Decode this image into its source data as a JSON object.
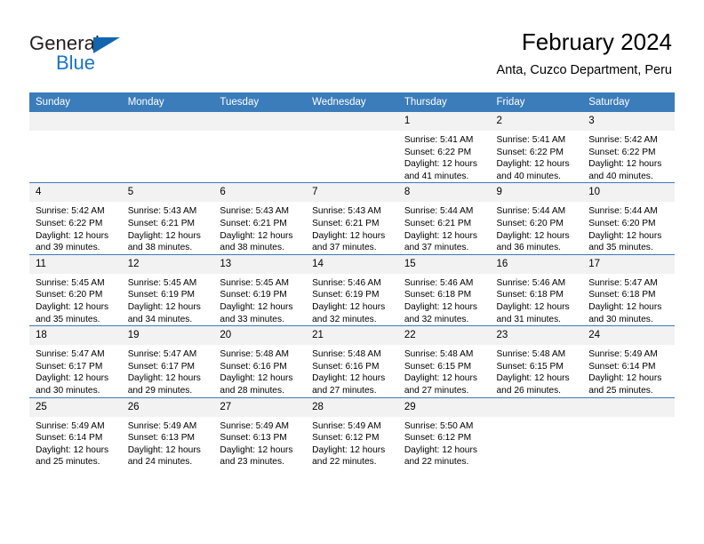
{
  "brand": {
    "name_top": "General",
    "name_bottom": "Blue",
    "triangle_icon": "blue-triangle-logo-mark",
    "color_dark": "#231f20",
    "color_blue": "#1a74c4"
  },
  "header": {
    "title": "February 2024",
    "subtitle": "Anta, Cuzco Department, Peru"
  },
  "colors": {
    "header_row_bg": "#3b7cba",
    "header_row_text": "#ffffff",
    "daynum_bg": "#f2f2f2",
    "cell_bg": "#ffffff",
    "grid_line": "#3b7cba"
  },
  "weekday_headers": [
    "Sunday",
    "Monday",
    "Tuesday",
    "Wednesday",
    "Thursday",
    "Friday",
    "Saturday"
  ],
  "labels": {
    "sunrise": "Sunrise:",
    "sunset": "Sunset:",
    "daylight": "Daylight:"
  },
  "weeks": [
    [
      {
        "day": "",
        "lines": []
      },
      {
        "day": "",
        "lines": []
      },
      {
        "day": "",
        "lines": []
      },
      {
        "day": "",
        "lines": []
      },
      {
        "day": "1",
        "lines": [
          "Sunrise: 5:41 AM",
          "Sunset: 6:22 PM",
          "Daylight: 12 hours",
          "and 41 minutes."
        ]
      },
      {
        "day": "2",
        "lines": [
          "Sunrise: 5:41 AM",
          "Sunset: 6:22 PM",
          "Daylight: 12 hours",
          "and 40 minutes."
        ]
      },
      {
        "day": "3",
        "lines": [
          "Sunrise: 5:42 AM",
          "Sunset: 6:22 PM",
          "Daylight: 12 hours",
          "and 40 minutes."
        ]
      }
    ],
    [
      {
        "day": "4",
        "lines": [
          "Sunrise: 5:42 AM",
          "Sunset: 6:22 PM",
          "Daylight: 12 hours",
          "and 39 minutes."
        ]
      },
      {
        "day": "5",
        "lines": [
          "Sunrise: 5:43 AM",
          "Sunset: 6:21 PM",
          "Daylight: 12 hours",
          "and 38 minutes."
        ]
      },
      {
        "day": "6",
        "lines": [
          "Sunrise: 5:43 AM",
          "Sunset: 6:21 PM",
          "Daylight: 12 hours",
          "and 38 minutes."
        ]
      },
      {
        "day": "7",
        "lines": [
          "Sunrise: 5:43 AM",
          "Sunset: 6:21 PM",
          "Daylight: 12 hours",
          "and 37 minutes."
        ]
      },
      {
        "day": "8",
        "lines": [
          "Sunrise: 5:44 AM",
          "Sunset: 6:21 PM",
          "Daylight: 12 hours",
          "and 37 minutes."
        ]
      },
      {
        "day": "9",
        "lines": [
          "Sunrise: 5:44 AM",
          "Sunset: 6:20 PM",
          "Daylight: 12 hours",
          "and 36 minutes."
        ]
      },
      {
        "day": "10",
        "lines": [
          "Sunrise: 5:44 AM",
          "Sunset: 6:20 PM",
          "Daylight: 12 hours",
          "and 35 minutes."
        ]
      }
    ],
    [
      {
        "day": "11",
        "lines": [
          "Sunrise: 5:45 AM",
          "Sunset: 6:20 PM",
          "Daylight: 12 hours",
          "and 35 minutes."
        ]
      },
      {
        "day": "12",
        "lines": [
          "Sunrise: 5:45 AM",
          "Sunset: 6:19 PM",
          "Daylight: 12 hours",
          "and 34 minutes."
        ]
      },
      {
        "day": "13",
        "lines": [
          "Sunrise: 5:45 AM",
          "Sunset: 6:19 PM",
          "Daylight: 12 hours",
          "and 33 minutes."
        ]
      },
      {
        "day": "14",
        "lines": [
          "Sunrise: 5:46 AM",
          "Sunset: 6:19 PM",
          "Daylight: 12 hours",
          "and 32 minutes."
        ]
      },
      {
        "day": "15",
        "lines": [
          "Sunrise: 5:46 AM",
          "Sunset: 6:18 PM",
          "Daylight: 12 hours",
          "and 32 minutes."
        ]
      },
      {
        "day": "16",
        "lines": [
          "Sunrise: 5:46 AM",
          "Sunset: 6:18 PM",
          "Daylight: 12 hours",
          "and 31 minutes."
        ]
      },
      {
        "day": "17",
        "lines": [
          "Sunrise: 5:47 AM",
          "Sunset: 6:18 PM",
          "Daylight: 12 hours",
          "and 30 minutes."
        ]
      }
    ],
    [
      {
        "day": "18",
        "lines": [
          "Sunrise: 5:47 AM",
          "Sunset: 6:17 PM",
          "Daylight: 12 hours",
          "and 30 minutes."
        ]
      },
      {
        "day": "19",
        "lines": [
          "Sunrise: 5:47 AM",
          "Sunset: 6:17 PM",
          "Daylight: 12 hours",
          "and 29 minutes."
        ]
      },
      {
        "day": "20",
        "lines": [
          "Sunrise: 5:48 AM",
          "Sunset: 6:16 PM",
          "Daylight: 12 hours",
          "and 28 minutes."
        ]
      },
      {
        "day": "21",
        "lines": [
          "Sunrise: 5:48 AM",
          "Sunset: 6:16 PM",
          "Daylight: 12 hours",
          "and 27 minutes."
        ]
      },
      {
        "day": "22",
        "lines": [
          "Sunrise: 5:48 AM",
          "Sunset: 6:15 PM",
          "Daylight: 12 hours",
          "and 27 minutes."
        ]
      },
      {
        "day": "23",
        "lines": [
          "Sunrise: 5:48 AM",
          "Sunset: 6:15 PM",
          "Daylight: 12 hours",
          "and 26 minutes."
        ]
      },
      {
        "day": "24",
        "lines": [
          "Sunrise: 5:49 AM",
          "Sunset: 6:14 PM",
          "Daylight: 12 hours",
          "and 25 minutes."
        ]
      }
    ],
    [
      {
        "day": "25",
        "lines": [
          "Sunrise: 5:49 AM",
          "Sunset: 6:14 PM",
          "Daylight: 12 hours",
          "and 25 minutes."
        ]
      },
      {
        "day": "26",
        "lines": [
          "Sunrise: 5:49 AM",
          "Sunset: 6:13 PM",
          "Daylight: 12 hours",
          "and 24 minutes."
        ]
      },
      {
        "day": "27",
        "lines": [
          "Sunrise: 5:49 AM",
          "Sunset: 6:13 PM",
          "Daylight: 12 hours",
          "and 23 minutes."
        ]
      },
      {
        "day": "28",
        "lines": [
          "Sunrise: 5:49 AM",
          "Sunset: 6:12 PM",
          "Daylight: 12 hours",
          "and 22 minutes."
        ]
      },
      {
        "day": "29",
        "lines": [
          "Sunrise: 5:50 AM",
          "Sunset: 6:12 PM",
          "Daylight: 12 hours",
          "and 22 minutes."
        ]
      },
      {
        "day": "",
        "lines": []
      },
      {
        "day": "",
        "lines": []
      }
    ]
  ]
}
